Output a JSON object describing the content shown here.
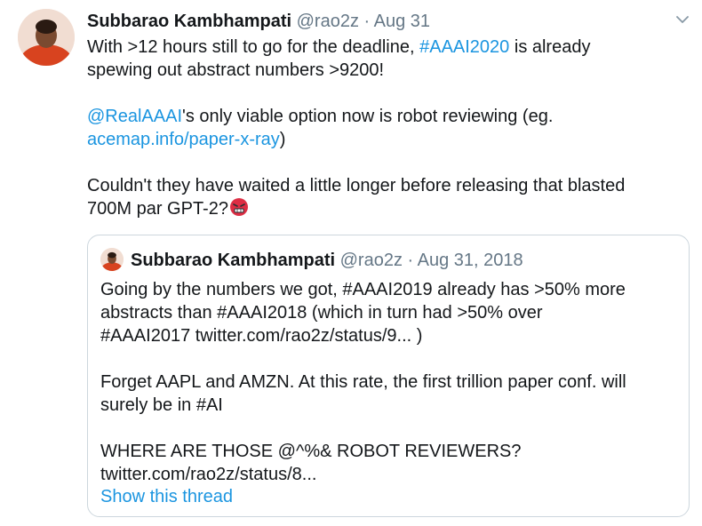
{
  "tweet": {
    "author_name": "Subbarao Kambhampati",
    "handle": "@rao2z",
    "separator": "·",
    "date": "Aug 31",
    "line1_pre": "With >12 hours still to go for the deadline, ",
    "line1_hashtag": "#AAAI2020",
    "line1_post": " is  already",
    "line2": "spewing out abstract numbers >9200!",
    "para2_mention": "@RealAAAI",
    "para2_text": "'s only viable option now is robot reviewing (eg.",
    "para2_link": "acemap.info/paper-x-ray",
    "para2_close": ")",
    "para3_line1": "Couldn't they have waited a little longer before releasing that blasted",
    "para3_line2": "700M par GPT-2?",
    "emoji": "angry-face-emoji",
    "menu_icon": "chevron-down-icon"
  },
  "quoted_tweet": {
    "author_name": "Subbarao Kambhampati",
    "handle": "@rao2z",
    "separator": "·",
    "date": "Aug 31, 2018",
    "line1": "Going by the numbers we got, #AAAI2019 already has >50% more",
    "line2": "abstracts than #AAAI2018 (which in turn had >50% over",
    "line3": "#AAAI2017 twitter.com/rao2z/status/9... )",
    "line4": "Forget AAPL and AMZN. At this rate, the first trillion paper conf. will",
    "line5": "surely be in #AI",
    "line6": "WHERE ARE THOSE @^%& ROBOT REVIEWERS?",
    "line7": "twitter.com/rao2z/status/8...",
    "show_thread": "Show this thread"
  },
  "colors": {
    "link": "#1b95e0",
    "muted": "#657786",
    "border": "#ccd6dd",
    "text": "#14171a"
  }
}
